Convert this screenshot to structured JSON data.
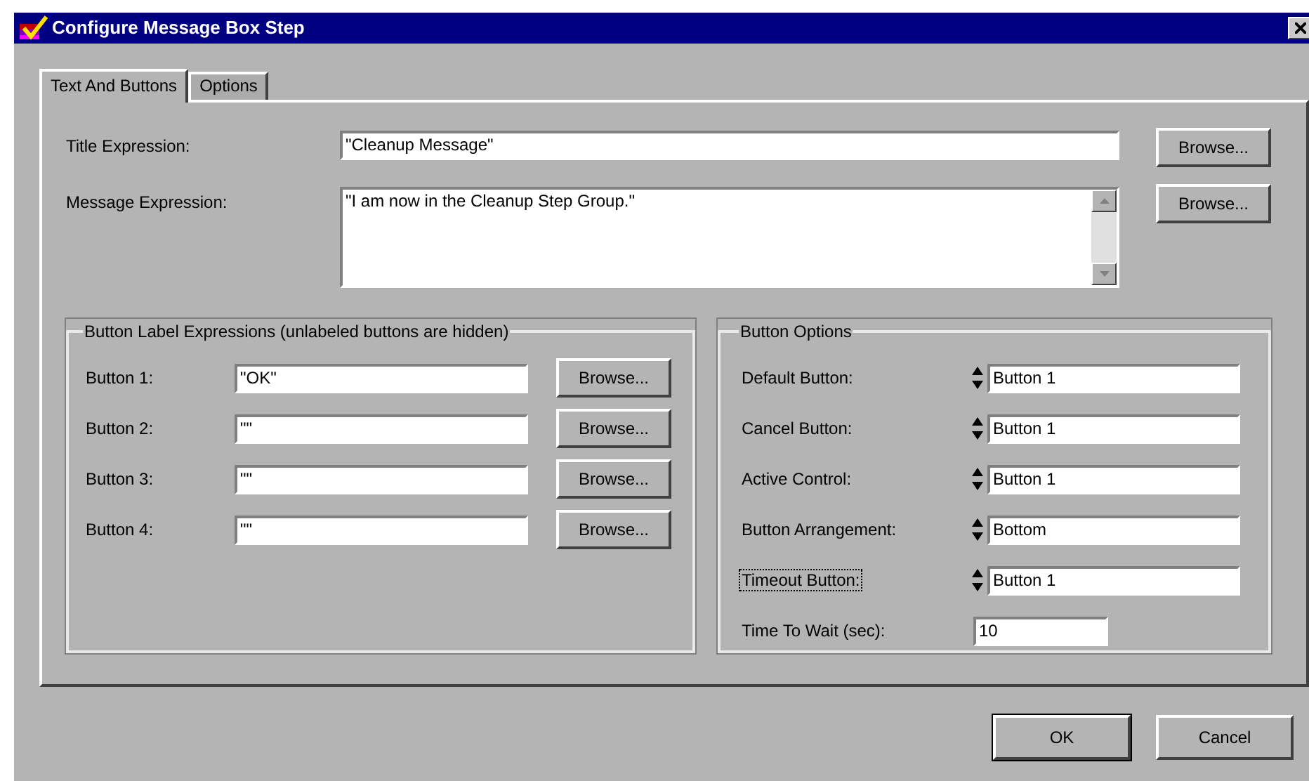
{
  "window": {
    "title": "Configure Message Box Step"
  },
  "tabs": [
    {
      "label": "Text And Buttons",
      "selected": true
    },
    {
      "label": "Options",
      "selected": false
    }
  ],
  "title_expression": {
    "label": "Title Expression:",
    "value": "\"Cleanup Message\"",
    "browse": "Browse..."
  },
  "message_expression": {
    "label": "Message Expression:",
    "value": "\"I am now in the Cleanup Step Group.\"",
    "browse": "Browse..."
  },
  "button_labels": {
    "title": "Button Label Expressions (unlabeled buttons are hidden)",
    "rows": [
      {
        "label": "Button 1:",
        "value": "\"OK\"",
        "browse": "Browse..."
      },
      {
        "label": "Button 2:",
        "value": "\"\"",
        "browse": "Browse..."
      },
      {
        "label": "Button 3:",
        "value": "\"\"",
        "browse": "Browse..."
      },
      {
        "label": "Button 4:",
        "value": "\"\"",
        "browse": "Browse..."
      }
    ]
  },
  "button_options": {
    "title": "Button Options",
    "rows": [
      {
        "kind": "spin",
        "label": "Default Button:",
        "value": "Button 1",
        "focused": false
      },
      {
        "kind": "spin",
        "label": "Cancel Button:",
        "value": "Button 1",
        "focused": false
      },
      {
        "kind": "spin",
        "label": "Active Control:",
        "value": "Button 1",
        "focused": false
      },
      {
        "kind": "spin",
        "label": "Button Arrangement:",
        "value": "Bottom",
        "focused": false
      },
      {
        "kind": "spin",
        "label": "Timeout Button:",
        "value": "Button 1",
        "focused": true
      },
      {
        "kind": "text",
        "label": "Time To Wait (sec):",
        "value": "10",
        "focused": false
      }
    ]
  },
  "buttons": [
    {
      "label": "OK",
      "default": true
    },
    {
      "label": "Cancel",
      "default": false
    }
  ]
}
